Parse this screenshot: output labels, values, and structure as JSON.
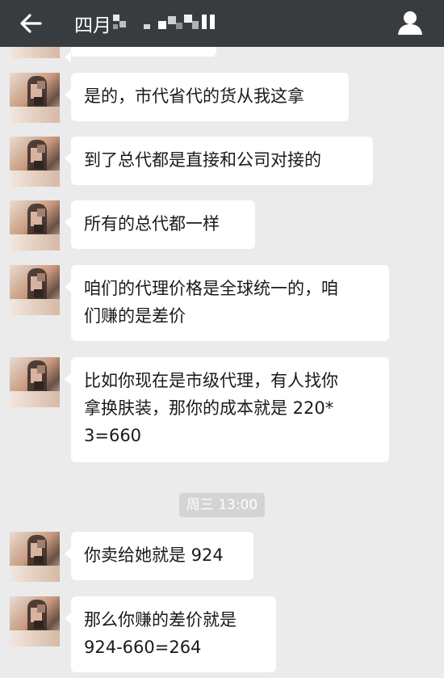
{
  "header": {
    "title_visible": "四月"
  },
  "messages": [
    {
      "lines": [
        "是的，市代省代的货从我这拿"
      ]
    },
    {
      "lines": [
        "到了总代都是直接和公司对接的"
      ]
    },
    {
      "lines": [
        "所有的总代都一样"
      ]
    },
    {
      "lines": [
        "咱们的代理价格是全球统一的，咱",
        "们赚的是差价"
      ]
    },
    {
      "lines": [
        "比如你现在是市级代理，有人找你",
        "拿换肤装，那你的成本就是 220*",
        "3=660"
      ]
    },
    {
      "lines": [
        "你卖给她就是 924"
      ]
    },
    {
      "lines": [
        "那么你赚的差价就是",
        "924-660=264"
      ]
    }
  ],
  "timestamp": "周三 13:00"
}
